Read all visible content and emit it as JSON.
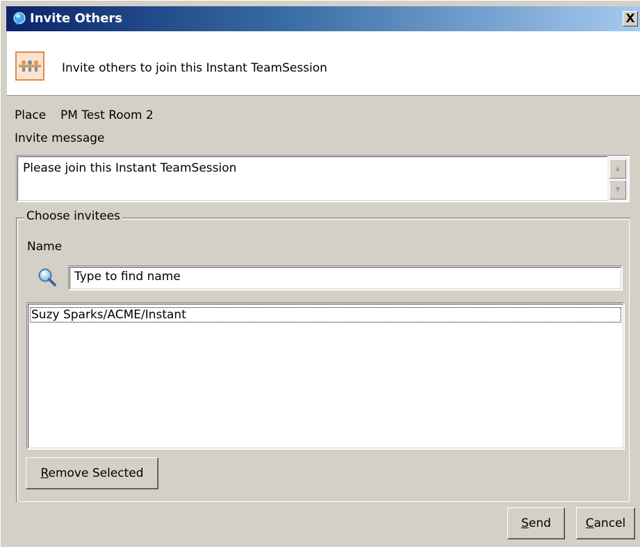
{
  "window": {
    "title": "Invite Others",
    "close_label": "X"
  },
  "banner": {
    "text": "Invite others to join this Instant TeamSession"
  },
  "place": {
    "label": "Place",
    "value": "PM Test Room 2"
  },
  "invite_message": {
    "label": "Invite message",
    "value": "Please join this Instant TeamSession"
  },
  "invitees": {
    "group_label": "Choose invitees",
    "name_label": "Name",
    "search_placeholder": "Type to find name",
    "items": [
      "Suzy Sparks/ACME/Instant"
    ],
    "remove_button": {
      "mnemonic": "R",
      "rest": "emove Selected"
    }
  },
  "footer": {
    "send_button": {
      "mnemonic": "S",
      "rest": "end"
    },
    "cancel_button": {
      "mnemonic": "C",
      "rest": "ancel"
    }
  },
  "colors": {
    "titlebar_start": "#0a246a",
    "titlebar_end": "#a6caf0",
    "dialog_bg": "#d4d0c8"
  }
}
